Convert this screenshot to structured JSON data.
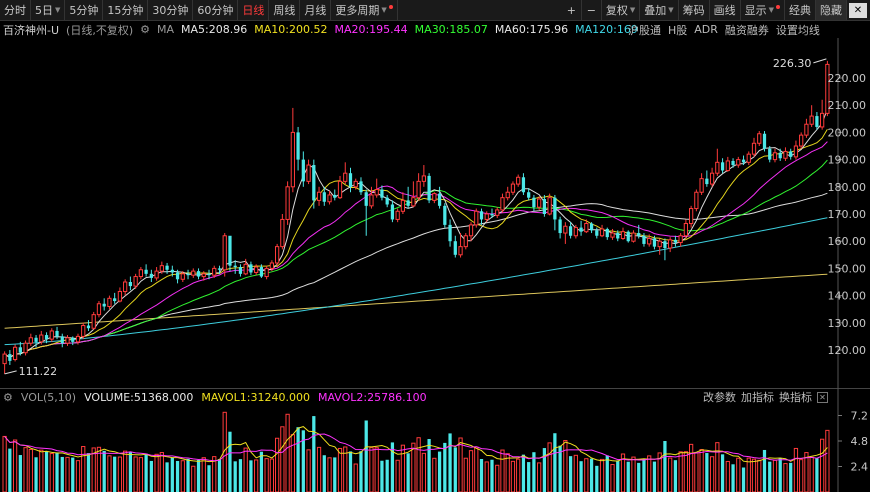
{
  "toolbar": {
    "periods": [
      {
        "label": "分时",
        "dropdown": false,
        "active": false
      },
      {
        "label": "5日",
        "dropdown": true,
        "active": false
      },
      {
        "label": "5分钟",
        "dropdown": false,
        "active": false
      },
      {
        "label": "15分钟",
        "dropdown": false,
        "active": false
      },
      {
        "label": "30分钟",
        "dropdown": false,
        "active": false
      },
      {
        "label": "60分钟",
        "dropdown": false,
        "active": false
      },
      {
        "label": "日线",
        "dropdown": false,
        "active": true
      },
      {
        "label": "周线",
        "dropdown": false,
        "active": false
      },
      {
        "label": "月线",
        "dropdown": false,
        "active": false
      },
      {
        "label": "更多周期",
        "dropdown": true,
        "active": false,
        "dot": true
      }
    ],
    "plus_label": "+",
    "minus_label": "−",
    "fuquan_label": "复权",
    "diejia_label": "叠加",
    "chouma_label": "筹码",
    "huaxian_label": "画线",
    "xianshi_label": "显示",
    "jingdian_label": "经典",
    "yincang_label": "隐藏"
  },
  "legend": {
    "stock_name": "百济神州-U",
    "mode": "(日线,不复权)",
    "ma_label": "MA",
    "ma": [
      {
        "label": "MA5:208.96",
        "color": "#e8e8e8"
      },
      {
        "label": "MA10:200.52",
        "color": "#f0e020"
      },
      {
        "label": "MA20:195.44",
        "color": "#ff33ff"
      },
      {
        "label": "MA30:185.07",
        "color": "#33ff33"
      },
      {
        "label": "MA60:175.96",
        "color": "#e8e8e8"
      },
      {
        "label": "MA120:169",
        "color": "#40d8e8"
      }
    ],
    "right_tabs": [
      "沪股通",
      "H股",
      "ADR",
      "融资融券",
      "设置均线"
    ]
  },
  "vol_legend": {
    "indicator": "VOL(5,10)",
    "items": [
      {
        "label": "VOLUME:51368.000",
        "color": "#e8e8e8"
      },
      {
        "label": "MAVOL1:31240.000",
        "color": "#f0e020"
      },
      {
        "label": "MAVOL2:25786.100",
        "color": "#ff33ff"
      }
    ],
    "tools": [
      "改参数",
      "加指标",
      "换指标"
    ]
  },
  "colors": {
    "up": "#ff3b3b",
    "down": "#4ce8e8",
    "ma5": "#e8e8e8",
    "ma10": "#f0e020",
    "ma20": "#ff33ff",
    "ma30": "#33ff33",
    "ma60": "#e8e8e8",
    "ma120": "#40d8e8",
    "ma250": "#e8d060"
  },
  "chart_data": {
    "type": "candlestick",
    "y_axis_ticks": [
      120,
      130,
      140,
      150,
      160,
      170,
      180,
      190,
      200,
      210,
      220
    ],
    "y_axis_tick_labels": [
      "120.00",
      "130.00",
      "140.00",
      "150.00",
      "160.00",
      "170.00",
      "180.00",
      "190.00",
      "200.00",
      "210.00",
      "220.00"
    ],
    "ylim": [
      106,
      228
    ],
    "max_annotation": {
      "value": 226.3,
      "label": "226.30"
    },
    "min_annotation": {
      "value": 111.22,
      "label": "111.22"
    },
    "candles": [
      {
        "o": 115.0,
        "c": 118.5,
        "h": 119.5,
        "l": 111.2
      },
      {
        "o": 118.5,
        "c": 116.0,
        "h": 120.0,
        "l": 114.5
      },
      {
        "o": 116.5,
        "c": 121.0,
        "h": 122.0,
        "l": 115.8
      },
      {
        "o": 121.0,
        "c": 119.0,
        "h": 123.0,
        "l": 118.0
      },
      {
        "o": 119.0,
        "c": 122.5,
        "h": 123.5,
        "l": 118.0
      },
      {
        "o": 122.5,
        "c": 124.5,
        "h": 126.0,
        "l": 121.5
      },
      {
        "o": 124.5,
        "c": 123.0,
        "h": 125.5,
        "l": 121.0
      },
      {
        "o": 123.0,
        "c": 125.5,
        "h": 127.0,
        "l": 122.0
      },
      {
        "o": 125.5,
        "c": 124.0,
        "h": 126.5,
        "l": 122.5
      },
      {
        "o": 124.0,
        "c": 127.0,
        "h": 128.0,
        "l": 123.0
      },
      {
        "o": 127.0,
        "c": 125.0,
        "h": 128.5,
        "l": 124.0
      },
      {
        "o": 125.0,
        "c": 122.5,
        "h": 126.0,
        "l": 121.0
      },
      {
        "o": 122.5,
        "c": 124.5,
        "h": 125.5,
        "l": 121.5
      },
      {
        "o": 124.5,
        "c": 123.0,
        "h": 125.0,
        "l": 121.8
      },
      {
        "o": 123.0,
        "c": 125.0,
        "h": 126.0,
        "l": 122.0
      },
      {
        "o": 125.0,
        "c": 129.0,
        "h": 130.0,
        "l": 124.0
      },
      {
        "o": 129.0,
        "c": 128.0,
        "h": 131.0,
        "l": 127.0
      },
      {
        "o": 128.0,
        "c": 133.0,
        "h": 134.0,
        "l": 127.5
      },
      {
        "o": 133.0,
        "c": 137.0,
        "h": 138.0,
        "l": 132.0
      },
      {
        "o": 137.0,
        "c": 136.0,
        "h": 139.0,
        "l": 134.5
      },
      {
        "o": 136.0,
        "c": 139.0,
        "h": 140.0,
        "l": 135.0
      },
      {
        "o": 139.0,
        "c": 138.0,
        "h": 141.0,
        "l": 137.0
      },
      {
        "o": 138.0,
        "c": 141.5,
        "h": 143.0,
        "l": 137.5
      },
      {
        "o": 141.5,
        "c": 145.0,
        "h": 146.0,
        "l": 140.0
      },
      {
        "o": 145.0,
        "c": 143.5,
        "h": 147.0,
        "l": 142.0
      },
      {
        "o": 143.5,
        "c": 147.0,
        "h": 148.0,
        "l": 142.5
      },
      {
        "o": 147.0,
        "c": 149.5,
        "h": 150.5,
        "l": 146.0
      },
      {
        "o": 149.5,
        "c": 148.0,
        "h": 151.5,
        "l": 147.0
      },
      {
        "o": 148.0,
        "c": 146.5,
        "h": 149.5,
        "l": 145.0
      },
      {
        "o": 146.5,
        "c": 149.0,
        "h": 150.5,
        "l": 145.5
      },
      {
        "o": 149.0,
        "c": 151.0,
        "h": 152.5,
        "l": 148.0
      },
      {
        "o": 151.0,
        "c": 149.5,
        "h": 152.0,
        "l": 148.0
      },
      {
        "o": 149.5,
        "c": 148.5,
        "h": 151.0,
        "l": 147.0
      },
      {
        "o": 148.5,
        "c": 146.0,
        "h": 149.5,
        "l": 144.5
      },
      {
        "o": 146.0,
        "c": 148.0,
        "h": 149.0,
        "l": 145.0
      },
      {
        "o": 148.0,
        "c": 147.5,
        "h": 149.5,
        "l": 146.0
      },
      {
        "o": 147.5,
        "c": 149.0,
        "h": 150.0,
        "l": 146.5
      },
      {
        "o": 149.0,
        "c": 147.0,
        "h": 150.0,
        "l": 146.0
      },
      {
        "o": 147.0,
        "c": 148.0,
        "h": 149.0,
        "l": 145.5
      },
      {
        "o": 148.0,
        "c": 147.5,
        "h": 149.5,
        "l": 146.0
      },
      {
        "o": 147.5,
        "c": 150.0,
        "h": 151.0,
        "l": 146.5
      },
      {
        "o": 150.0,
        "c": 149.5,
        "h": 151.0,
        "l": 148.0
      },
      {
        "o": 149.5,
        "c": 162.0,
        "h": 163.0,
        "l": 147.0
      },
      {
        "o": 162.0,
        "c": 151.0,
        "h": 160.0,
        "l": 149.0
      },
      {
        "o": 151.0,
        "c": 150.5,
        "h": 153.0,
        "l": 148.0
      },
      {
        "o": 150.5,
        "c": 148.0,
        "h": 151.5,
        "l": 147.0
      },
      {
        "o": 148.0,
        "c": 151.5,
        "h": 153.5,
        "l": 147.5
      },
      {
        "o": 151.5,
        "c": 148.5,
        "h": 152.5,
        "l": 147.5
      },
      {
        "o": 148.5,
        "c": 150.5,
        "h": 151.5,
        "l": 147.5
      },
      {
        "o": 150.5,
        "c": 147.0,
        "h": 151.5,
        "l": 146.5
      },
      {
        "o": 147.0,
        "c": 150.0,
        "h": 151.0,
        "l": 146.0
      },
      {
        "o": 150.0,
        "c": 152.0,
        "h": 153.0,
        "l": 149.0
      },
      {
        "o": 152.0,
        "c": 158.0,
        "h": 159.0,
        "l": 151.0
      },
      {
        "o": 158.0,
        "c": 168.0,
        "h": 170.0,
        "l": 157.0
      },
      {
        "o": 168.0,
        "c": 180.0,
        "h": 182.0,
        "l": 166.0
      },
      {
        "o": 180.0,
        "c": 200.0,
        "h": 209.0,
        "l": 178.0
      },
      {
        "o": 200.0,
        "c": 190.0,
        "h": 202.0,
        "l": 186.0
      },
      {
        "o": 190.0,
        "c": 182.0,
        "h": 193.0,
        "l": 180.0
      },
      {
        "o": 182.0,
        "c": 188.0,
        "h": 190.0,
        "l": 181.0
      },
      {
        "o": 188.0,
        "c": 175.0,
        "h": 190.0,
        "l": 172.0
      },
      {
        "o": 175.0,
        "c": 178.0,
        "h": 180.0,
        "l": 173.0
      },
      {
        "o": 178.0,
        "c": 174.5,
        "h": 180.0,
        "l": 173.0
      },
      {
        "o": 174.5,
        "c": 177.0,
        "h": 178.5,
        "l": 173.5
      },
      {
        "o": 177.0,
        "c": 176.0,
        "h": 179.0,
        "l": 175.0
      },
      {
        "o": 176.0,
        "c": 182.0,
        "h": 184.0,
        "l": 175.5
      },
      {
        "o": 182.0,
        "c": 185.0,
        "h": 189.0,
        "l": 181.0
      },
      {
        "o": 185.0,
        "c": 180.0,
        "h": 187.0,
        "l": 178.0
      },
      {
        "o": 180.0,
        "c": 182.0,
        "h": 183.0,
        "l": 179.0
      },
      {
        "o": 182.0,
        "c": 178.0,
        "h": 183.5,
        "l": 177.0
      },
      {
        "o": 178.0,
        "c": 173.0,
        "h": 179.0,
        "l": 162.0
      },
      {
        "o": 173.0,
        "c": 177.0,
        "h": 180.0,
        "l": 172.0
      },
      {
        "o": 177.0,
        "c": 179.0,
        "h": 183.0,
        "l": 176.0
      },
      {
        "o": 179.0,
        "c": 176.0,
        "h": 180.5,
        "l": 175.0
      },
      {
        "o": 176.0,
        "c": 173.5,
        "h": 177.0,
        "l": 172.5
      },
      {
        "o": 173.5,
        "c": 168.0,
        "h": 175.0,
        "l": 167.0
      },
      {
        "o": 168.0,
        "c": 171.0,
        "h": 172.0,
        "l": 167.0
      },
      {
        "o": 171.0,
        "c": 175.0,
        "h": 178.0,
        "l": 170.0
      },
      {
        "o": 175.0,
        "c": 173.0,
        "h": 180.0,
        "l": 172.0
      },
      {
        "o": 173.0,
        "c": 176.0,
        "h": 182.0,
        "l": 172.5
      },
      {
        "o": 176.0,
        "c": 182.0,
        "h": 185.0,
        "l": 175.0
      },
      {
        "o": 182.0,
        "c": 184.0,
        "h": 188.0,
        "l": 180.0
      },
      {
        "o": 184.0,
        "c": 175.0,
        "h": 185.0,
        "l": 174.0
      },
      {
        "o": 175.0,
        "c": 177.5,
        "h": 178.0,
        "l": 174.0
      },
      {
        "o": 177.5,
        "c": 173.0,
        "h": 180.0,
        "l": 172.0
      },
      {
        "o": 173.0,
        "c": 166.0,
        "h": 174.0,
        "l": 165.0
      },
      {
        "o": 166.0,
        "c": 160.0,
        "h": 168.0,
        "l": 158.0
      },
      {
        "o": 160.0,
        "c": 155.0,
        "h": 162.0,
        "l": 154.0
      },
      {
        "o": 155.0,
        "c": 158.0,
        "h": 163.0,
        "l": 154.0
      },
      {
        "o": 158.0,
        "c": 162.0,
        "h": 163.0,
        "l": 157.0
      },
      {
        "o": 162.0,
        "c": 166.0,
        "h": 167.0,
        "l": 160.0
      },
      {
        "o": 166.0,
        "c": 171.0,
        "h": 172.0,
        "l": 165.0
      },
      {
        "o": 171.0,
        "c": 168.0,
        "h": 172.0,
        "l": 166.0
      },
      {
        "o": 168.0,
        "c": 170.0,
        "h": 171.0,
        "l": 167.0
      },
      {
        "o": 170.0,
        "c": 169.5,
        "h": 172.0,
        "l": 168.5
      },
      {
        "o": 169.5,
        "c": 171.5,
        "h": 172.5,
        "l": 168.5
      },
      {
        "o": 171.5,
        "c": 176.0,
        "h": 177.5,
        "l": 170.5
      },
      {
        "o": 176.0,
        "c": 178.0,
        "h": 180.0,
        "l": 175.0
      },
      {
        "o": 178.0,
        "c": 181.0,
        "h": 182.0,
        "l": 177.0
      },
      {
        "o": 181.0,
        "c": 183.5,
        "h": 184.5,
        "l": 180.0
      },
      {
        "o": 183.5,
        "c": 178.0,
        "h": 185.0,
        "l": 177.0
      },
      {
        "o": 178.0,
        "c": 176.0,
        "h": 179.5,
        "l": 175.0
      },
      {
        "o": 176.0,
        "c": 172.5,
        "h": 177.0,
        "l": 171.0
      },
      {
        "o": 172.5,
        "c": 175.5,
        "h": 176.5,
        "l": 171.5
      },
      {
        "o": 175.5,
        "c": 170.0,
        "h": 177.0,
        "l": 169.0
      },
      {
        "o": 170.0,
        "c": 176.0,
        "h": 177.5,
        "l": 169.5
      },
      {
        "o": 176.0,
        "c": 168.0,
        "h": 177.0,
        "l": 164.0
      },
      {
        "o": 168.0,
        "c": 163.0,
        "h": 169.0,
        "l": 161.0
      },
      {
        "o": 163.0,
        "c": 165.5,
        "h": 167.0,
        "l": 159.0
      },
      {
        "o": 165.5,
        "c": 162.0,
        "h": 167.0,
        "l": 161.0
      },
      {
        "o": 162.0,
        "c": 165.0,
        "h": 166.0,
        "l": 161.0
      },
      {
        "o": 165.0,
        "c": 163.5,
        "h": 167.5,
        "l": 162.0
      },
      {
        "o": 163.5,
        "c": 166.5,
        "h": 168.0,
        "l": 163.0
      },
      {
        "o": 166.5,
        "c": 164.0,
        "h": 167.0,
        "l": 163.0
      },
      {
        "o": 164.0,
        "c": 162.0,
        "h": 165.0,
        "l": 161.0
      },
      {
        "o": 162.0,
        "c": 164.5,
        "h": 166.0,
        "l": 161.5
      },
      {
        "o": 164.5,
        "c": 161.5,
        "h": 165.0,
        "l": 160.5
      },
      {
        "o": 161.5,
        "c": 163.0,
        "h": 164.5,
        "l": 160.5
      },
      {
        "o": 163.0,
        "c": 161.0,
        "h": 164.0,
        "l": 160.0
      },
      {
        "o": 161.0,
        "c": 163.5,
        "h": 165.0,
        "l": 160.5
      },
      {
        "o": 163.5,
        "c": 160.0,
        "h": 164.0,
        "l": 159.5
      },
      {
        "o": 160.0,
        "c": 163.0,
        "h": 164.0,
        "l": 159.5
      },
      {
        "o": 163.0,
        "c": 162.0,
        "h": 166.0,
        "l": 161.0
      },
      {
        "o": 162.0,
        "c": 159.0,
        "h": 163.0,
        "l": 158.0
      },
      {
        "o": 159.0,
        "c": 161.0,
        "h": 162.5,
        "l": 158.0
      },
      {
        "o": 161.0,
        "c": 158.0,
        "h": 162.0,
        "l": 157.0
      },
      {
        "o": 158.0,
        "c": 160.0,
        "h": 161.0,
        "l": 155.0
      },
      {
        "o": 160.0,
        "c": 157.5,
        "h": 161.0,
        "l": 153.0
      },
      {
        "o": 157.5,
        "c": 160.5,
        "h": 161.5,
        "l": 156.0
      },
      {
        "o": 160.5,
        "c": 159.5,
        "h": 162.0,
        "l": 158.0
      },
      {
        "o": 159.5,
        "c": 162.0,
        "h": 163.0,
        "l": 158.0
      },
      {
        "o": 162.0,
        "c": 166.5,
        "h": 168.0,
        "l": 161.0
      },
      {
        "o": 166.5,
        "c": 172.0,
        "h": 173.0,
        "l": 165.0
      },
      {
        "o": 172.0,
        "c": 178.0,
        "h": 179.0,
        "l": 171.0
      },
      {
        "o": 178.0,
        "c": 183.0,
        "h": 185.0,
        "l": 177.0
      },
      {
        "o": 183.0,
        "c": 181.0,
        "h": 186.0,
        "l": 180.0
      },
      {
        "o": 181.0,
        "c": 185.0,
        "h": 187.0,
        "l": 180.0
      },
      {
        "o": 185.0,
        "c": 189.0,
        "h": 194.0,
        "l": 184.0
      },
      {
        "o": 189.0,
        "c": 186.0,
        "h": 190.5,
        "l": 185.0
      },
      {
        "o": 186.0,
        "c": 189.5,
        "h": 191.0,
        "l": 185.5
      },
      {
        "o": 189.5,
        "c": 188.0,
        "h": 190.5,
        "l": 187.0
      },
      {
        "o": 188.0,
        "c": 190.0,
        "h": 191.0,
        "l": 187.0
      },
      {
        "o": 190.0,
        "c": 189.0,
        "h": 191.5,
        "l": 188.0
      },
      {
        "o": 189.0,
        "c": 192.0,
        "h": 193.0,
        "l": 188.0
      },
      {
        "o": 192.0,
        "c": 196.0,
        "h": 198.0,
        "l": 191.0
      },
      {
        "o": 196.0,
        "c": 199.5,
        "h": 200.5,
        "l": 195.0
      },
      {
        "o": 199.5,
        "c": 194.0,
        "h": 200.5,
        "l": 193.0
      },
      {
        "o": 194.0,
        "c": 190.0,
        "h": 195.0,
        "l": 189.0
      },
      {
        "o": 190.0,
        "c": 192.5,
        "h": 194.0,
        "l": 189.0
      },
      {
        "o": 192.5,
        "c": 190.5,
        "h": 194.0,
        "l": 189.5
      },
      {
        "o": 190.5,
        "c": 193.0,
        "h": 194.5,
        "l": 189.5
      },
      {
        "o": 193.0,
        "c": 191.0,
        "h": 194.0,
        "l": 190.0
      },
      {
        "o": 191.0,
        "c": 195.0,
        "h": 197.0,
        "l": 190.0
      },
      {
        "o": 195.0,
        "c": 199.0,
        "h": 200.0,
        "l": 194.0
      },
      {
        "o": 199.0,
        "c": 203.0,
        "h": 205.0,
        "l": 198.0
      },
      {
        "o": 203.0,
        "c": 206.0,
        "h": 210.0,
        "l": 202.0
      },
      {
        "o": 206.0,
        "c": 202.0,
        "h": 207.5,
        "l": 201.0
      },
      {
        "o": 202.0,
        "c": 207.0,
        "h": 212.0,
        "l": 201.0
      },
      {
        "o": 207.0,
        "c": 225.0,
        "h": 226.3,
        "l": 206.0
      }
    ],
    "volume_axis_ticks": [
      2.4,
      4.8,
      7.2
    ],
    "volume_axis_labels": [
      "2.4",
      "4.8",
      "7.2"
    ],
    "volume_scale_max": 8.0,
    "volume_unit_note": ""
  }
}
